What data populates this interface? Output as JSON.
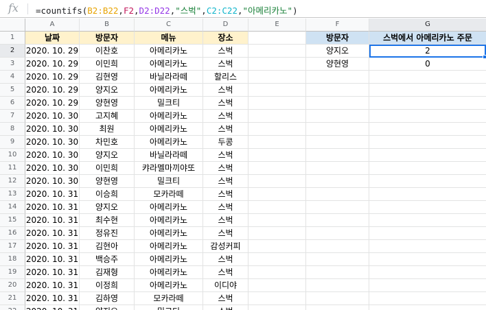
{
  "formula_bar": {
    "icon": "fx-icon",
    "segments": [
      {
        "text": "=countifs(",
        "color": "#202124"
      },
      {
        "text": "B2:B22",
        "color": "#e7a300"
      },
      {
        "text": ",",
        "color": "#202124"
      },
      {
        "text": "F2",
        "color": "#c2185b"
      },
      {
        "text": ",",
        "color": "#202124"
      },
      {
        "text": "D2:D22",
        "color": "#9334e6"
      },
      {
        "text": ",",
        "color": "#202124"
      },
      {
        "text": "\"스벅\"",
        "color": "#188038"
      },
      {
        "text": ",",
        "color": "#202124"
      },
      {
        "text": "C2:C22",
        "color": "#12b5cb"
      },
      {
        "text": ",",
        "color": "#202124"
      },
      {
        "text": "\"아메리카노\"",
        "color": "#188038"
      },
      {
        "text": ")",
        "color": "#202124"
      }
    ]
  },
  "columns": [
    "A",
    "B",
    "C",
    "D",
    "E",
    "F",
    "G"
  ],
  "header_row": {
    "num": "1",
    "A": "날짜",
    "B": "방문자",
    "C": "메뉴",
    "D": "장소",
    "E": "",
    "F": "방문자",
    "G": "스벅에서 아메리카노 주문"
  },
  "rows": [
    {
      "num": "2",
      "date": "2020. 10. 29",
      "visitor": "이찬호",
      "menu": "아메리카노",
      "place": "스벅",
      "f": "양지오",
      "g": "2"
    },
    {
      "num": "3",
      "date": "2020. 10. 29",
      "visitor": "이민희",
      "menu": "아메리카노",
      "place": "스벅",
      "f": "양현영",
      "g": "0"
    },
    {
      "num": "4",
      "date": "2020. 10. 29",
      "visitor": "김현영",
      "menu": "바닐라라떼",
      "place": "할리스",
      "f": "",
      "g": ""
    },
    {
      "num": "5",
      "date": "2020. 10. 29",
      "visitor": "양지오",
      "menu": "아메리카노",
      "place": "스벅",
      "f": "",
      "g": ""
    },
    {
      "num": "6",
      "date": "2020. 10. 29",
      "visitor": "양현영",
      "menu": "밀크티",
      "place": "스벅",
      "f": "",
      "g": ""
    },
    {
      "num": "7",
      "date": "2020. 10. 30",
      "visitor": "고지혜",
      "menu": "아메리카노",
      "place": "스벅",
      "f": "",
      "g": ""
    },
    {
      "num": "8",
      "date": "2020. 10. 30",
      "visitor": "최원",
      "menu": "아메리카노",
      "place": "스벅",
      "f": "",
      "g": ""
    },
    {
      "num": "9",
      "date": "2020. 10. 30",
      "visitor": "차민호",
      "menu": "아메리카노",
      "place": "두콩",
      "f": "",
      "g": ""
    },
    {
      "num": "10",
      "date": "2020. 10. 30",
      "visitor": "양지오",
      "menu": "바닐라라떼",
      "place": "스벅",
      "f": "",
      "g": ""
    },
    {
      "num": "11",
      "date": "2020. 10. 30",
      "visitor": "이민희",
      "menu": "캬라멜마끼야또",
      "place": "스벅",
      "f": "",
      "g": ""
    },
    {
      "num": "12",
      "date": "2020. 10. 30",
      "visitor": "양현영",
      "menu": "밀크티",
      "place": "스벅",
      "f": "",
      "g": ""
    },
    {
      "num": "13",
      "date": "2020. 10. 31",
      "visitor": "이승희",
      "menu": "모카라떼",
      "place": "스벅",
      "f": "",
      "g": ""
    },
    {
      "num": "14",
      "date": "2020. 10. 31",
      "visitor": "양지오",
      "menu": "아메리카노",
      "place": "스벅",
      "f": "",
      "g": ""
    },
    {
      "num": "15",
      "date": "2020. 10. 31",
      "visitor": "최수현",
      "menu": "아메리카노",
      "place": "스벅",
      "f": "",
      "g": ""
    },
    {
      "num": "16",
      "date": "2020. 10. 31",
      "visitor": "정유진",
      "menu": "아메리카노",
      "place": "스벅",
      "f": "",
      "g": ""
    },
    {
      "num": "17",
      "date": "2020. 10. 31",
      "visitor": "김현아",
      "menu": "아메리카노",
      "place": "감성커피",
      "f": "",
      "g": ""
    },
    {
      "num": "18",
      "date": "2020. 10. 31",
      "visitor": "백승주",
      "menu": "아메리카노",
      "place": "스벅",
      "f": "",
      "g": ""
    },
    {
      "num": "19",
      "date": "2020. 10. 31",
      "visitor": "김재형",
      "menu": "아메리카노",
      "place": "스벅",
      "f": "",
      "g": ""
    },
    {
      "num": "20",
      "date": "2020. 10. 31",
      "visitor": "이정희",
      "menu": "아메리카노",
      "place": "이디야",
      "f": "",
      "g": ""
    },
    {
      "num": "21",
      "date": "2020. 10. 31",
      "visitor": "김하영",
      "menu": "모카라떼",
      "place": "스벅",
      "f": "",
      "g": ""
    },
    {
      "num": "22",
      "date": "2020. 10. 31",
      "visitor": "양지오",
      "menu": "밀크티",
      "place": "스벅",
      "f": "",
      "g": ""
    }
  ],
  "colors": {
    "header_yellow": "#fff2cc",
    "header_blue": "#cfe2f3",
    "selection": "#1a73e8"
  }
}
